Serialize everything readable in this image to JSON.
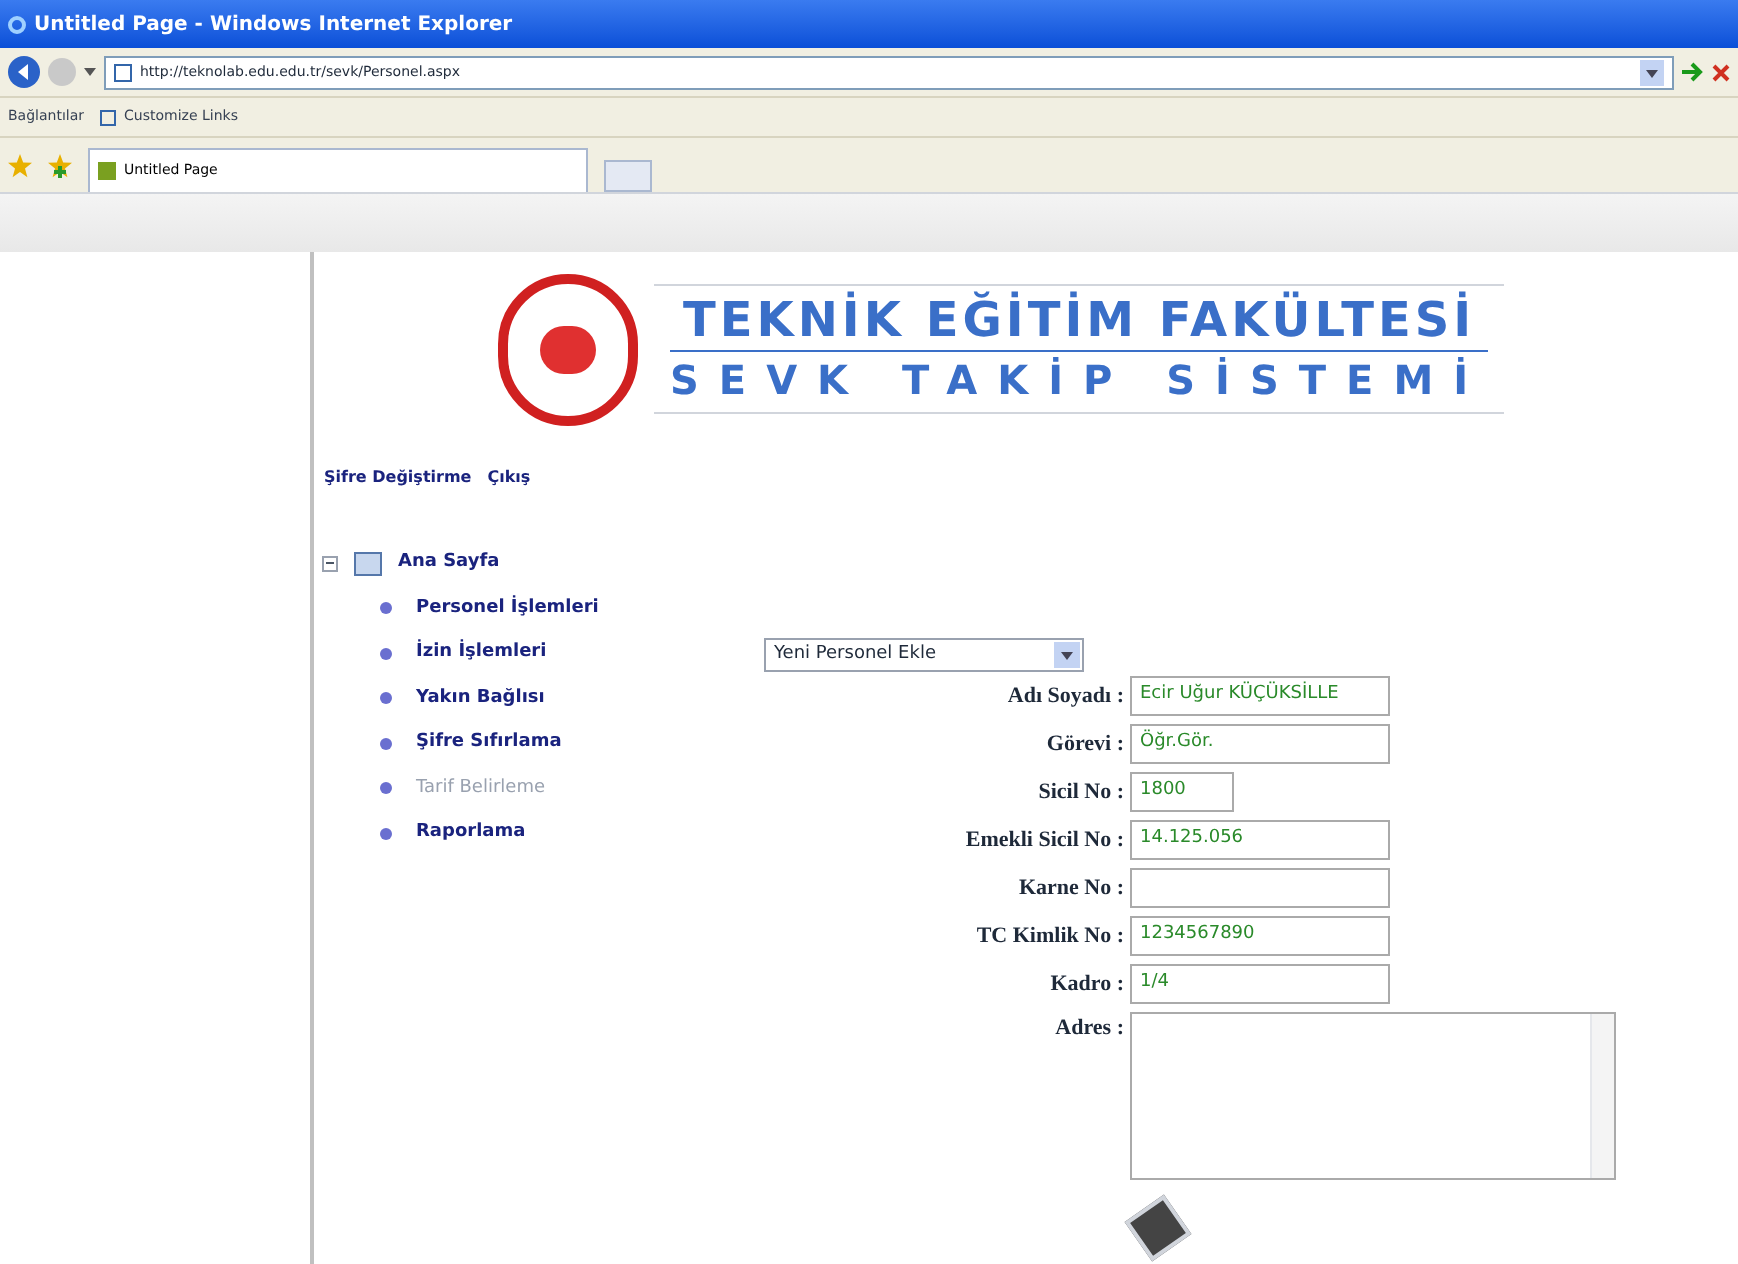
{
  "window": {
    "title": "Untitled Page - Windows Internet Explorer"
  },
  "address_bar": {
    "url": "http://teknolab.edu.edu.tr/sevk/Personel.aspx"
  },
  "links_bar": {
    "label": "Bağlantılar",
    "items": [
      "Customize Links"
    ]
  },
  "tabs": [
    {
      "label": "Untitled Page",
      "selected": true
    }
  ],
  "header": {
    "line_1": "TEKNİK EĞİTİM FAKÜLTESİ",
    "line_2": "SEVK TAKİP SİSTEMİ"
  },
  "top_links": [
    "Şifre Değiştirme",
    "Çıkış"
  ],
  "tree": {
    "label": "Ana Sayfa",
    "expanded": true,
    "children": [
      {
        "label": "Personel İşlemleri",
        "disabled": false
      },
      {
        "label": "İzin İşlemleri",
        "disabled": false
      },
      {
        "label": "Yakın Bağlısı",
        "disabled": false
      },
      {
        "label": "Şifre Sıfırlama",
        "disabled": false
      },
      {
        "label": "Tarif Belirleme",
        "disabled": true
      },
      {
        "label": "Raporlama",
        "disabled": false
      }
    ]
  },
  "mode_select": {
    "value": "Yeni Personel Ekle"
  },
  "form": [
    {
      "label": "Adı Soyadı :",
      "value": "Ecir Uğur KÜÇÜKSİLLE",
      "kind": "wide"
    },
    {
      "label": "Görevi :",
      "value": "Öğr.Gör.",
      "kind": "wide"
    },
    {
      "label": "Sicil No :",
      "value": "1800",
      "kind": "short"
    },
    {
      "label": "Emekli Sicil No :",
      "value": "14.125.056",
      "kind": "wide"
    },
    {
      "label": "Karne No :",
      "kind": "wide"
    },
    {
      "label": "TC Kimlik No :",
      "value": "1234567890",
      "kind": "wide"
    },
    {
      "label": "Kadro :",
      "value": "1/4",
      "kind": "wide"
    }
  ],
  "address_field": {
    "label": "Adres :"
  }
}
